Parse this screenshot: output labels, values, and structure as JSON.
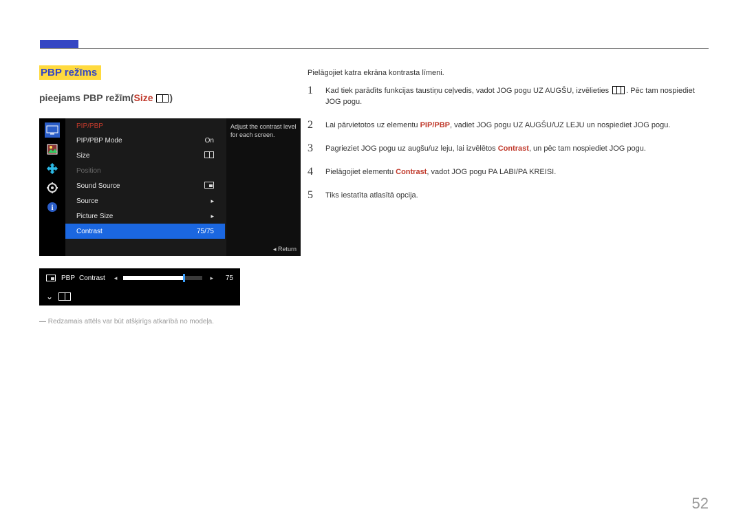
{
  "page": {
    "number": "52"
  },
  "heading": "PBP režīms",
  "subheading": {
    "prefix": "pieejams PBP režīm(",
    "size_label": "Size",
    "suffix": ")"
  },
  "osd": {
    "title": "PIP/PBP",
    "hint": "Adjust the contrast level for each screen.",
    "return": "Return",
    "rows": [
      {
        "label": "PIP/PBP Mode",
        "value": "On",
        "kind": "text"
      },
      {
        "label": "Size",
        "value_icon": "dual",
        "kind": "icon"
      },
      {
        "label": "Position",
        "kind": "disabled"
      },
      {
        "label": "Sound Source",
        "value_icon": "pip",
        "kind": "icon"
      },
      {
        "label": "Source",
        "kind": "more"
      },
      {
        "label": "Picture Size",
        "kind": "more"
      },
      {
        "label": "Contrast",
        "value": "75/75",
        "kind": "text",
        "selected": true
      }
    ]
  },
  "slider": {
    "badge": "PBP",
    "label": "Contrast",
    "value": "75",
    "percent": 75
  },
  "footnote": "Redzamais attēls var būt atšķirīgs atkarībā no modeļa.",
  "intro": "Pielāgojiet katra ekrāna kontrasta līmeni.",
  "steps": [
    {
      "num": "1",
      "pre": "Kad tiek parādīts funkcijas taustiņu ceļvedis, vadot JOG pogu UZ AUGŠU, izvēlieties ",
      "icon": "grid",
      "post": ". Pēc tam nospiediet JOG pogu."
    },
    {
      "num": "2",
      "pre": "Lai pārvietotos uz elementu ",
      "kw": "PIP/PBP",
      "post": ", vadiet JOG pogu UZ AUGŠU/UZ LEJU un nospiediet JOG pogu."
    },
    {
      "num": "3",
      "pre": "Pagrieziet JOG pogu uz augšu/uz leju, lai izvēlētos ",
      "kw": "Contrast",
      "post": ", un pēc tam nospiediet JOG pogu."
    },
    {
      "num": "4",
      "pre": "Pielāgojiet elementu ",
      "kw": "Contrast",
      "post": ", vadot JOG pogu PA LABI/PA KREISI."
    },
    {
      "num": "5",
      "pre": "Tiks iestatīta atlasītā opcija."
    }
  ]
}
